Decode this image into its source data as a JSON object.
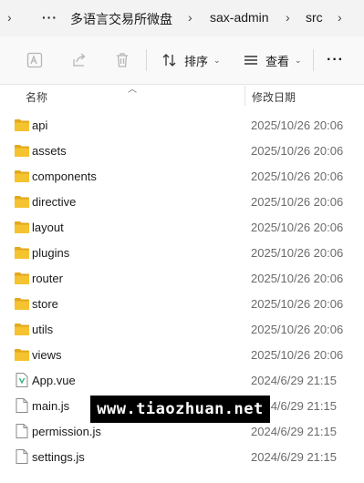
{
  "breadcrumb": {
    "more": "···",
    "items": [
      "多语言交易所微盘",
      "sax-admin",
      "src"
    ]
  },
  "toolbar": {
    "sort_label": "排序",
    "view_label": "查看",
    "more_label": "···"
  },
  "columns": {
    "name": "名称",
    "date_modified": "修改日期"
  },
  "files": [
    {
      "name": "api",
      "date": "2025/10/26 20:06",
      "type": "folder"
    },
    {
      "name": "assets",
      "date": "2025/10/26 20:06",
      "type": "folder"
    },
    {
      "name": "components",
      "date": "2025/10/26 20:06",
      "type": "folder"
    },
    {
      "name": "directive",
      "date": "2025/10/26 20:06",
      "type": "folder"
    },
    {
      "name": "layout",
      "date": "2025/10/26 20:06",
      "type": "folder"
    },
    {
      "name": "plugins",
      "date": "2025/10/26 20:06",
      "type": "folder"
    },
    {
      "name": "router",
      "date": "2025/10/26 20:06",
      "type": "folder"
    },
    {
      "name": "store",
      "date": "2025/10/26 20:06",
      "type": "folder"
    },
    {
      "name": "utils",
      "date": "2025/10/26 20:06",
      "type": "folder"
    },
    {
      "name": "views",
      "date": "2025/10/26 20:06",
      "type": "folder"
    },
    {
      "name": "App.vue",
      "date": "2024/6/29 21:15",
      "type": "vue"
    },
    {
      "name": "main.js",
      "date": "2024/6/29 21:15",
      "type": "js"
    },
    {
      "name": "permission.js",
      "date": "2024/6/29 21:15",
      "type": "js"
    },
    {
      "name": "settings.js",
      "date": "2024/6/29 21:15",
      "type": "js"
    }
  ],
  "watermark": "www.tiaozhuan.net",
  "colors": {
    "folder": "#f5c230",
    "folder_tab": "#e3a81c",
    "vue_green": "#41b883"
  }
}
